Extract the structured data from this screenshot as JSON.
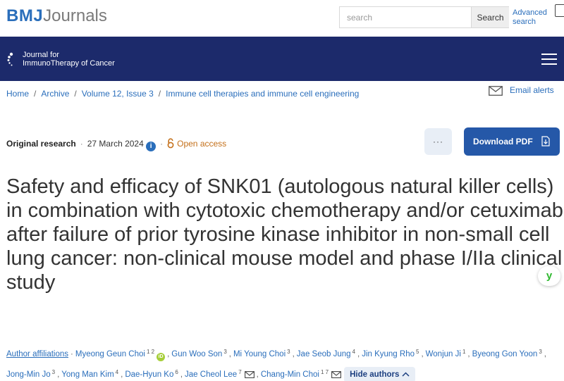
{
  "header": {
    "logo_bmj": "BMJ",
    "logo_journals": "Journals",
    "search_placeholder": "search",
    "search_button": "Search",
    "advanced_search": "Advanced search"
  },
  "journal": {
    "title_line1": "Journal for",
    "title_line2": "ImmunoTherapy of Cancer"
  },
  "breadcrumb": [
    "Home",
    "Archive",
    "Volume 12, Issue 3",
    "Immune cell therapies and immune cell engineering"
  ],
  "email_alerts": "Email alerts",
  "article": {
    "type": "Original research",
    "date": "27 March 2024",
    "open_access": "Open access",
    "more_label": "···",
    "download_label": "Download PDF",
    "title": "Safety and efficacy of SNK01 (autologous natural killer cells) in combination with cytotoxic chemotherapy and/or cetuximab after failure of prior tyrosine kinase inhibitor in non-small cell lung cancer: non-clinical mouse model and phase I/IIa clinical study"
  },
  "authors": {
    "affiliations_label": "Author affiliations",
    "list": [
      {
        "name": "Myeong Geun Choi",
        "sup": "1 2"
      },
      {
        "name": "Gun Woo Son",
        "sup": "3"
      },
      {
        "name": "Mi Young Choi",
        "sup": "3"
      },
      {
        "name": "Jae Seob Jung",
        "sup": "4"
      },
      {
        "name": "Jin Kyung Rho",
        "sup": "5"
      },
      {
        "name": "Wonjun Ji",
        "sup": "1"
      },
      {
        "name": "Byeong Gon Yoon",
        "sup": "3"
      },
      {
        "name": "Jong-Min Jo",
        "sup": "3"
      },
      {
        "name": "Yong Man Kim",
        "sup": "4"
      },
      {
        "name": "Dae-Hyun Ko",
        "sup": "6"
      },
      {
        "name": "Jae Cheol Lee",
        "sup": "7"
      },
      {
        "name": "Chang-Min Choi",
        "sup": "1 7"
      }
    ],
    "orcid_label": "iD",
    "hide_label": "Hide authors"
  },
  "side_widget": "y",
  "colors": {
    "brand_blue": "#2a6ebb",
    "band_navy": "#1c2a6b",
    "download_blue": "#2558a8",
    "open_access_orange": "#c4701a",
    "orcid_green": "#a6ce39"
  }
}
